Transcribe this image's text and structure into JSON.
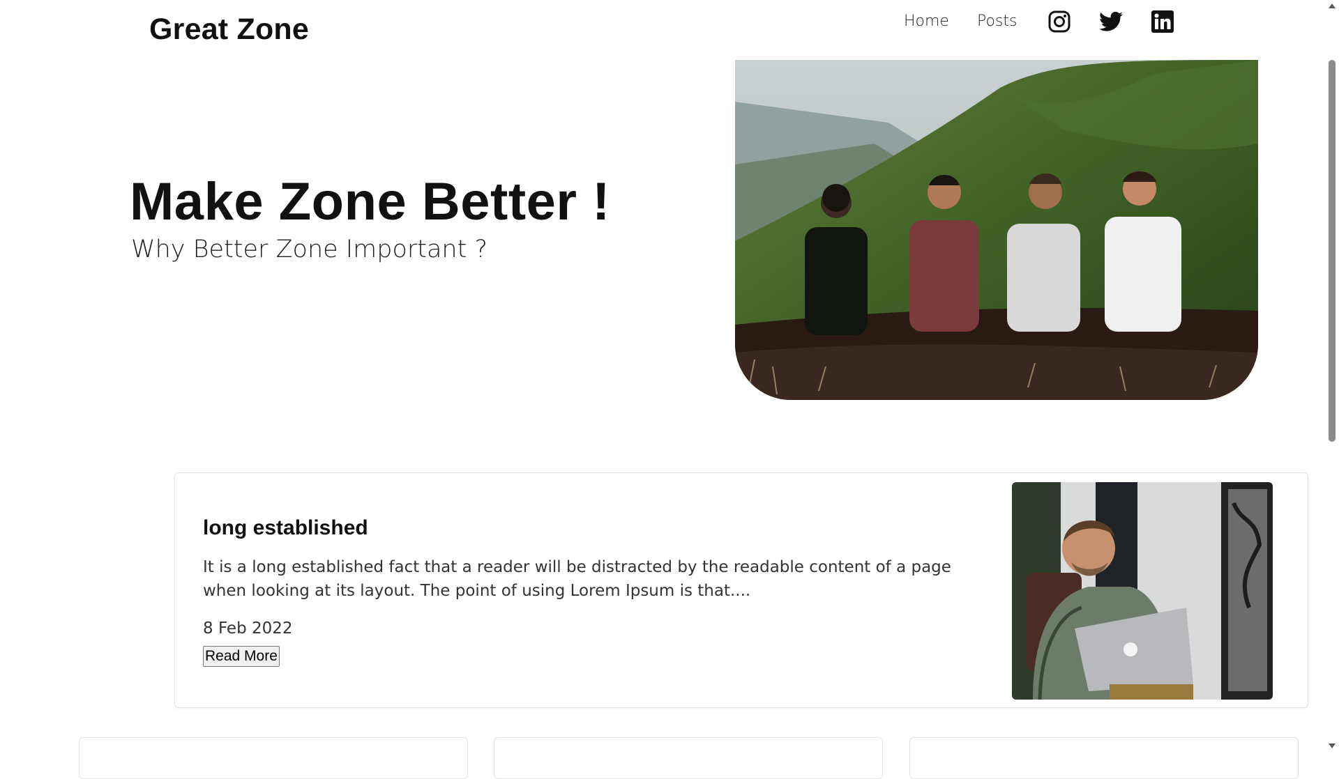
{
  "brand": "Great Zone",
  "nav": {
    "links": [
      {
        "label": "Home"
      },
      {
        "label": "Posts"
      }
    ],
    "social": [
      "instagram-icon",
      "twitter-icon",
      "linkedin-icon"
    ]
  },
  "hero": {
    "title": "Make Zone Better !",
    "subtitle": "Why Better Zone Important ?",
    "image": "four friends sitting on green mountain slope"
  },
  "post": {
    "title": "long established",
    "excerpt": "It is a long established fact that a reader will be distracted by the readable content of a page when looking at its layout. The point of using Lorem Ipsum is that....",
    "date": "8 Feb 2022",
    "read_more": "Read More",
    "image": "man with laptop in plaid shirt"
  },
  "colors": {
    "text": "#111111",
    "border": "#e2e2e2",
    "background": "#ffffff"
  }
}
